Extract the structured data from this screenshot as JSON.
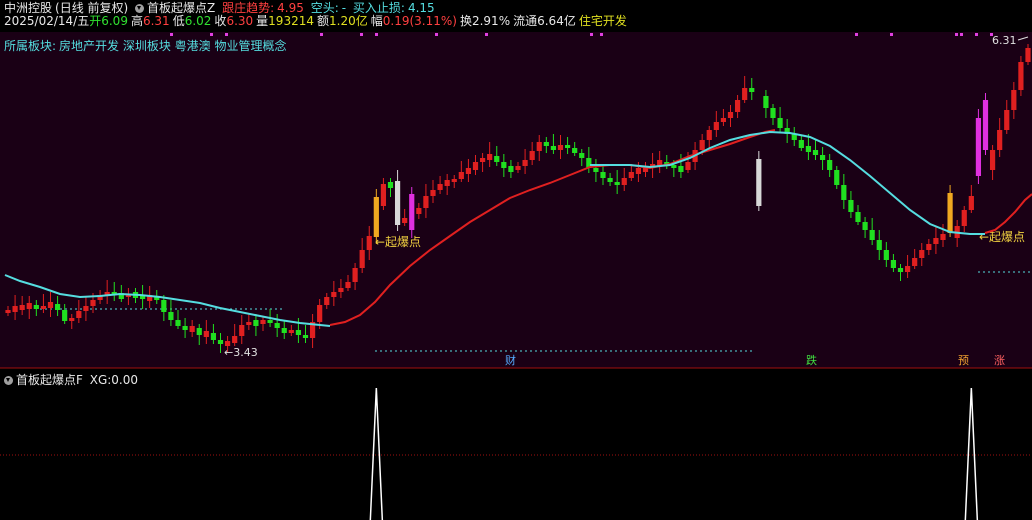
{
  "header": {
    "stock_name": "中洲控股",
    "period": "(日线 前复权)",
    "indicator_name": "首板起爆点Z",
    "trend_label": "跟庄趋势:",
    "trend_value": "4.95",
    "short_label": "空头:",
    "short_value": "-",
    "buy_stop_label": "买入止损:",
    "buy_stop_value": "4.15"
  },
  "quote": {
    "date": "2025/02/14/五",
    "open_label": "开",
    "open": "6.09",
    "high_label": "高",
    "high": "6.31",
    "low_label": "低",
    "low": "6.02",
    "close_label": "收",
    "close": "6.30",
    "vol_label": "量",
    "vol": "193214",
    "amount_label": "额",
    "amount": "1.20亿",
    "change_label": "幅",
    "change": "0.19(3.11%)",
    "turnover_label": "换",
    "turnover": "2.91%",
    "float_label": "流通",
    "float": "6.64亿",
    "industry": "住宅开发"
  },
  "sector": {
    "label": "所属板块:",
    "items": "房地产开发 深圳板块 粤港澳 物业管理概念"
  },
  "annotations": {
    "price_max": "6.31",
    "price_min": "3.43",
    "signal_1": "←起爆点",
    "signal_2": "←起爆点",
    "event_cai": "财",
    "event_die": "跌",
    "event_yu": "预",
    "event_zhang": "涨"
  },
  "sub_panel": {
    "indicator_name": "首板起爆点F",
    "xg_label": "XG:",
    "xg_value": "0.00"
  },
  "colors": {
    "up": "#e02020",
    "down": "#20e020",
    "ma_red": "#e02020",
    "ma_cyan": "#55dde0",
    "chart_bg": "#1a0015"
  },
  "chart_data": {
    "type": "candlestick",
    "signals": [
      {
        "index": 52,
        "value": 1
      },
      {
        "index": 136,
        "value": 1
      }
    ],
    "price_high_label": 6.31,
    "price_low_label": 3.43
  }
}
